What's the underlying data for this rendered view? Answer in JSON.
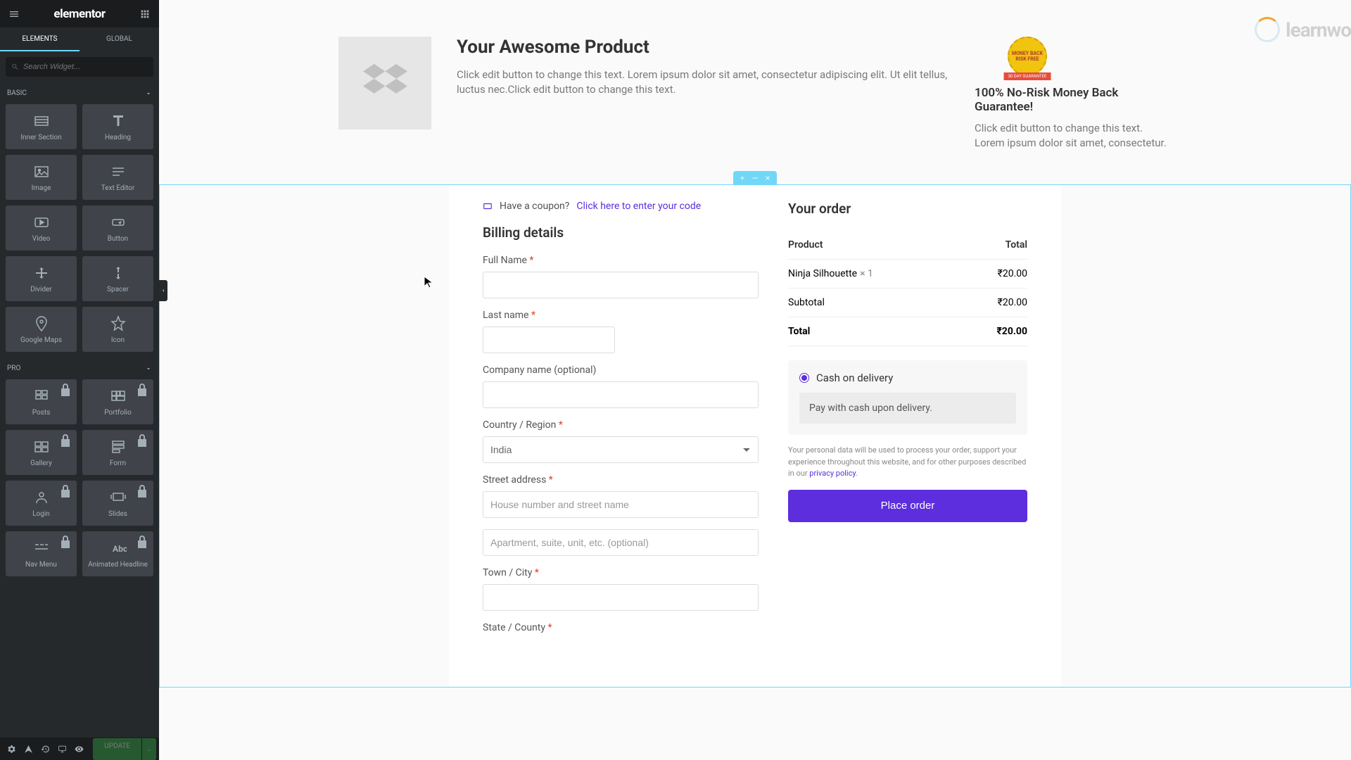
{
  "sidebar": {
    "logo": "elementor",
    "tabs": {
      "elements": "ELEMENTS",
      "global": "GLOBAL"
    },
    "search_placeholder": "Search Widget...",
    "categories": {
      "basic": "BASIC",
      "pro": "PRO"
    },
    "widgets_basic": [
      {
        "label": "Inner Section"
      },
      {
        "label": "Heading"
      },
      {
        "label": "Image"
      },
      {
        "label": "Text Editor"
      },
      {
        "label": "Video"
      },
      {
        "label": "Button"
      },
      {
        "label": "Divider"
      },
      {
        "label": "Spacer"
      },
      {
        "label": "Google Maps"
      },
      {
        "label": "Icon"
      }
    ],
    "widgets_pro": [
      {
        "label": "Posts"
      },
      {
        "label": "Portfolio"
      },
      {
        "label": "Gallery"
      },
      {
        "label": "Form"
      },
      {
        "label": "Login"
      },
      {
        "label": "Slides"
      },
      {
        "label": "Nav Menu"
      },
      {
        "label": "Animated Headline"
      }
    ],
    "update": "UPDATE"
  },
  "watermark": {
    "text1": "learn",
    "text2": "wo"
  },
  "hero": {
    "title": "Your Awesome Product",
    "desc": "Click edit button to change this text. Lorem ipsum dolor sit amet, consectetur adipiscing elit. Ut elit tellus, luctus nec.Click edit button to change this text.",
    "badge_inner": "MONEY BACK RISK FREE",
    "badge_ribbon": "30 DAY GUARANTEE",
    "guarantee_title": "100% No-Risk Money Back Guarantee!",
    "guarantee_desc": "Click edit button to change this text. Lorem ipsum dolor sit amet, consectetur."
  },
  "checkout": {
    "coupon_text": "Have a coupon?",
    "coupon_link": "Click here to enter your code",
    "billing_title": "Billing details",
    "fields": {
      "full_name": "Full Name",
      "last_name": "Last name",
      "company": "Company name (optional)",
      "country": "Country / Region",
      "country_value": "India",
      "street": "Street address",
      "street_ph1": "House number and street name",
      "street_ph2": "Apartment, suite, unit, etc. (optional)",
      "town": "Town / City",
      "state": "State / County"
    },
    "order": {
      "title": "Your order",
      "product_h": "Product",
      "total_h": "Total",
      "item_name": "Ninja Silhouette",
      "item_qty": "× 1",
      "item_price": "₹20.00",
      "subtotal_label": "Subtotal",
      "subtotal_value": "₹20.00",
      "total_label": "Total",
      "total_value": "₹20.00"
    },
    "payment": {
      "method": "Cash on delivery",
      "desc": "Pay with cash upon delivery."
    },
    "privacy": {
      "text": "Your personal data will be used to process your order, support your experience throughout this website, and for other purposes described in our ",
      "link": "privacy policy"
    },
    "place_order": "Place order"
  }
}
